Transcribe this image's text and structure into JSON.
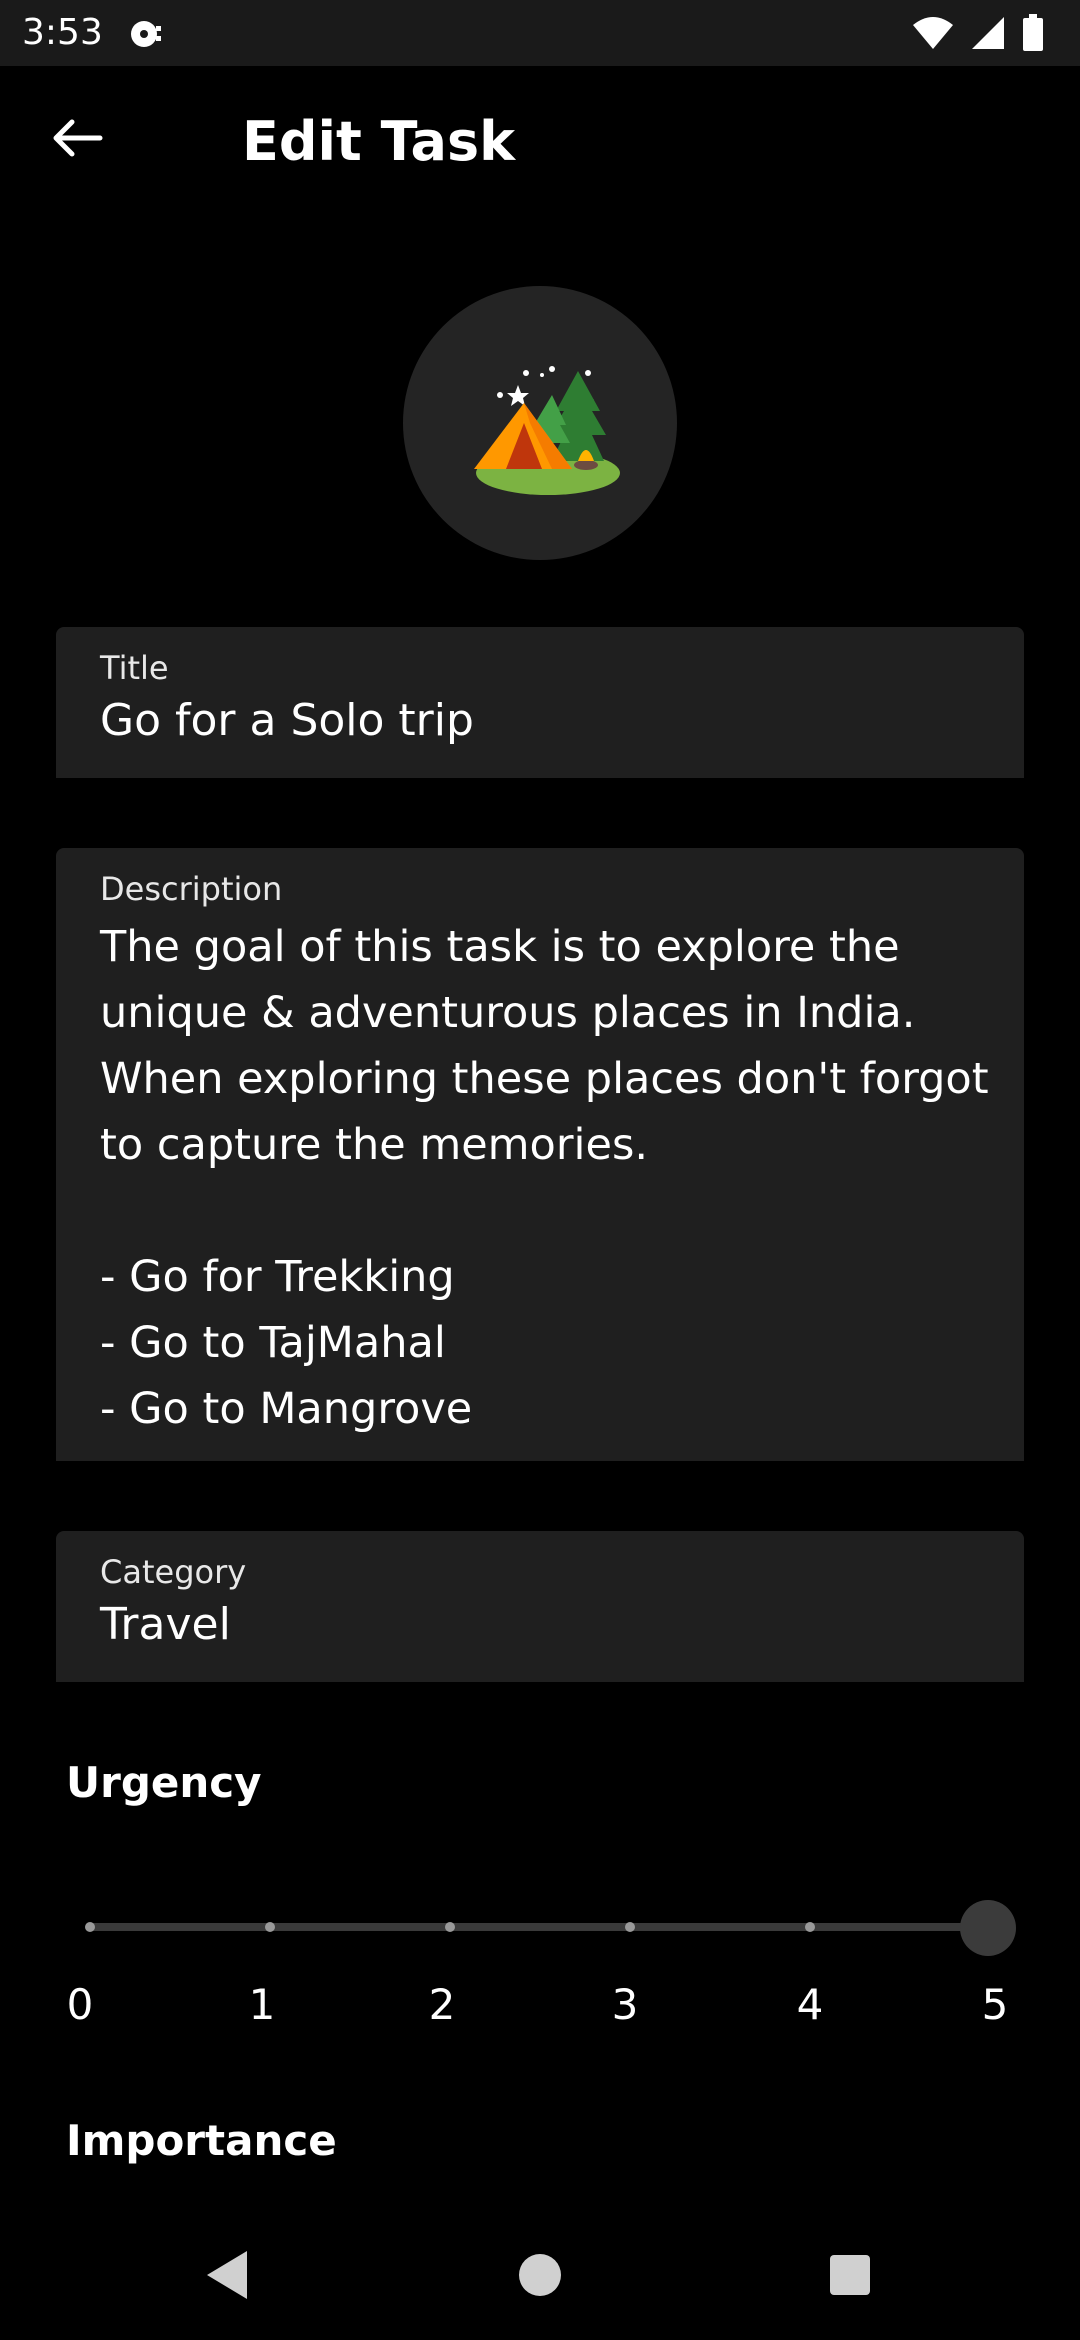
{
  "status_bar": {
    "time": "3:53",
    "left_icon": "media-icon",
    "right_icons": [
      "wifi-icon",
      "signal-icon",
      "battery-icon"
    ]
  },
  "app_bar": {
    "back_icon": "arrow-left-icon",
    "title": "Edit Task"
  },
  "task_emoji": "camping-icon",
  "title_field": {
    "label": "Title",
    "value": "Go for a Solo trip"
  },
  "description_field": {
    "label": "Description",
    "value": "The goal of this task is to explore the\nunique & adventurous places in India.\nWhen exploring these places don't forgot\nto capture the memories.\n\n- Go for Trekking\n- Go to TajMahal\n- Go to Mangrove"
  },
  "category_field": {
    "label": "Category",
    "value": "Travel"
  },
  "urgency": {
    "label": "Urgency",
    "ticks": [
      "0",
      "1",
      "2",
      "3",
      "4",
      "5"
    ],
    "value": 5
  },
  "importance": {
    "label": "Importance"
  },
  "nav_bar": {
    "icons": [
      "back-triangle-icon",
      "home-circle-icon",
      "recents-square-icon"
    ]
  },
  "colors": {
    "background": "#000000",
    "field_background": "#1f1f1f",
    "status_bar": "#1a1a1a"
  }
}
